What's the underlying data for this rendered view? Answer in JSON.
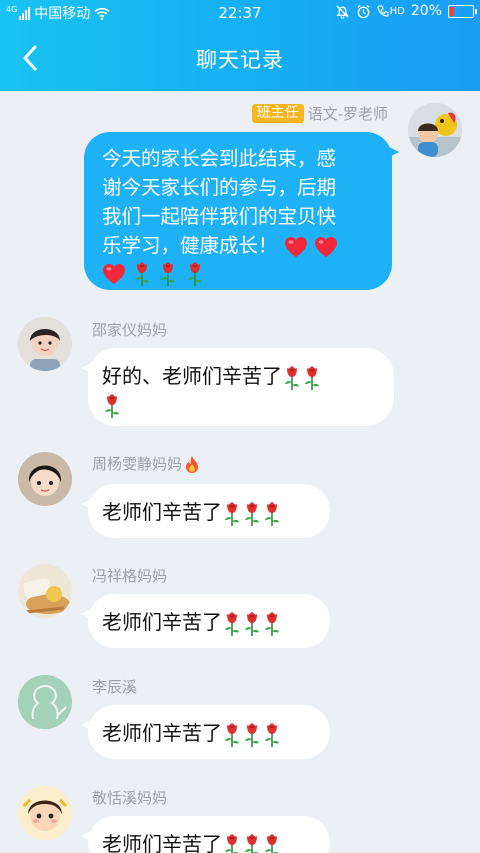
{
  "status_bar": {
    "network_tag": "4G",
    "carrier": "中国移动",
    "time": "22:37",
    "volte": "HD",
    "battery": "20%",
    "battery_level": 0.2
  },
  "header": {
    "title": "聊天记录",
    "back_icon": "chevron-left-icon"
  },
  "colors": {
    "header": "#16aef3",
    "outgoing_bubble": "#1fb1f6",
    "role_badge": "#f5b622",
    "background": "#eceff4"
  },
  "teacher_message": {
    "role": "班主任",
    "sender": "语文-罗老师",
    "lines": [
      "今天的家长会到此结束，感",
      "谢今天家长们的参与，后期",
      "我们一起陪伴我们的宝贝快",
      "乐学习，健康成长！"
    ],
    "emojis": [
      "red-heart",
      "red-heart",
      "red-heart",
      "rose",
      "rose",
      "rose"
    ]
  },
  "replies": [
    {
      "name": "邵家仪妈妈",
      "text": "好的、老师们辛苦了",
      "roses": 3,
      "badge": ""
    },
    {
      "name": "周杨雯静妈妈",
      "text": "老师们辛苦了",
      "roses": 3,
      "badge": "fire-icon"
    },
    {
      "name": "冯祥格妈妈",
      "text": "老师们辛苦了",
      "roses": 3,
      "badge": ""
    },
    {
      "name": "李辰溪",
      "text": "老师们辛苦了",
      "roses": 3,
      "badge": ""
    },
    {
      "name": "敬恬溪妈妈",
      "text": "老师们辛苦了",
      "roses": 3,
      "badge": ""
    }
  ]
}
